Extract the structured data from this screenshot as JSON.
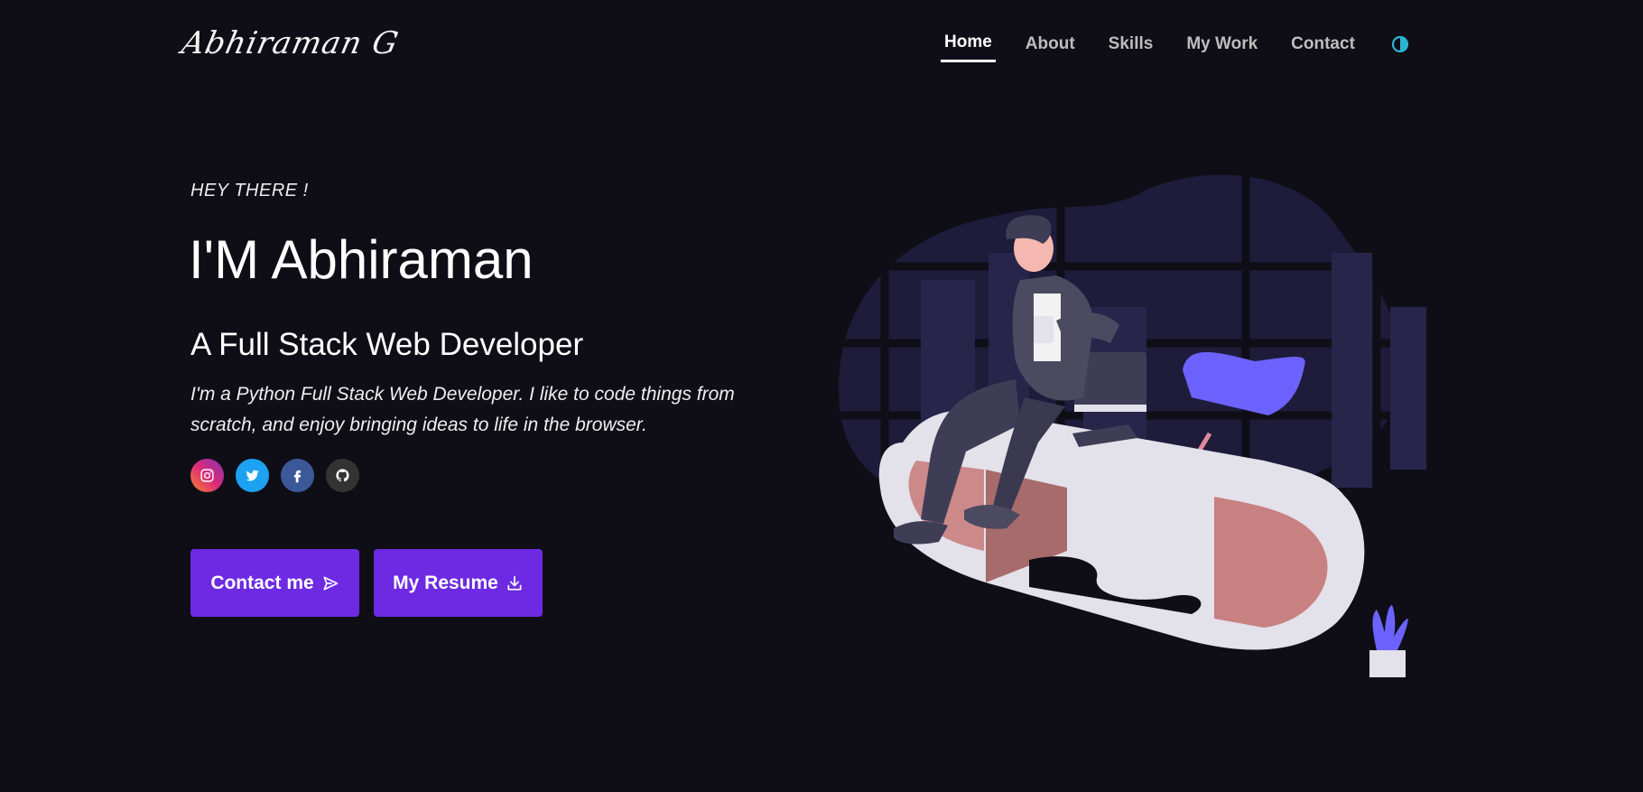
{
  "logo": {
    "text": "Abhiraman G"
  },
  "nav": {
    "items": [
      "Home",
      "About",
      "Skills",
      "My Work",
      "Contact"
    ],
    "active": "Home",
    "theme_icon": "half-circle-icon"
  },
  "hero": {
    "greeting": "HEY THERE !",
    "name": "I'M Abhiraman",
    "role": "A Full Stack Web Developer",
    "description": "I'm a Python Full Stack Web Developer. I like to code things from scratch, and enjoy bringing ideas to life in the browser."
  },
  "socials": [
    "instagram-icon",
    "twitter-icon",
    "facebook-icon",
    "github-icon"
  ],
  "buttons": {
    "contact": "Contact me",
    "resume": "My Resume"
  },
  "colors": {
    "background": "#0f0e17",
    "accent": "#6d2ae2",
    "toggle": "#2bb5d3"
  }
}
